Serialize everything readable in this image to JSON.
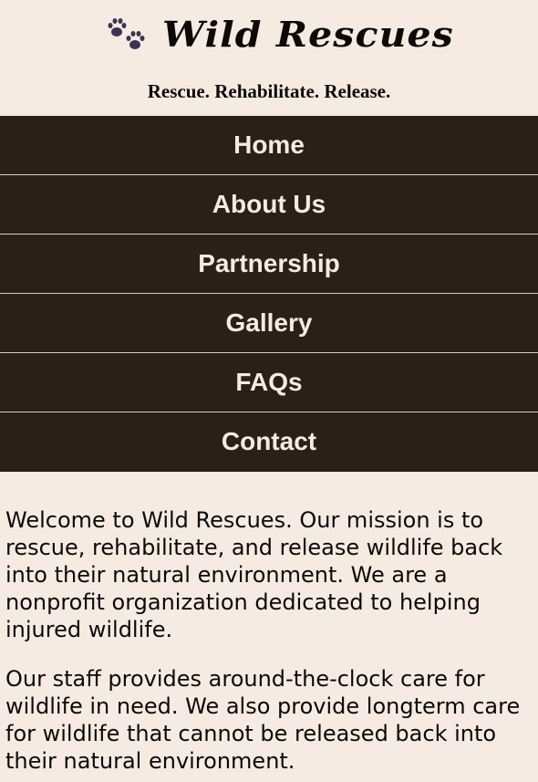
{
  "header": {
    "logo_icon": "paw-prints-icon",
    "logo_color": "#3d3350",
    "title": "Wild Rescues",
    "tagline": "Rescue. Rehabilitate. Release."
  },
  "nav": {
    "items": [
      {
        "label": "Home"
      },
      {
        "label": "About Us"
      },
      {
        "label": "Partnership"
      },
      {
        "label": "Gallery"
      },
      {
        "label": "FAQs"
      },
      {
        "label": "Contact"
      }
    ]
  },
  "main": {
    "paragraphs": [
      "Welcome to Wild Rescues. Our mission is to rescue, rehabilitate, and release wildlife back into their natural environment. We are a nonprofit organization dedicated to helping injured wildlife.",
      "Our staff provides around-the-clock care for wildlife in need. We also provide longterm care for wildlife that cannot be released back into their natural environment."
    ]
  },
  "colors": {
    "background": "#f5ebe2",
    "nav_background": "#2b2017",
    "nav_text": "#f5ebe2"
  }
}
